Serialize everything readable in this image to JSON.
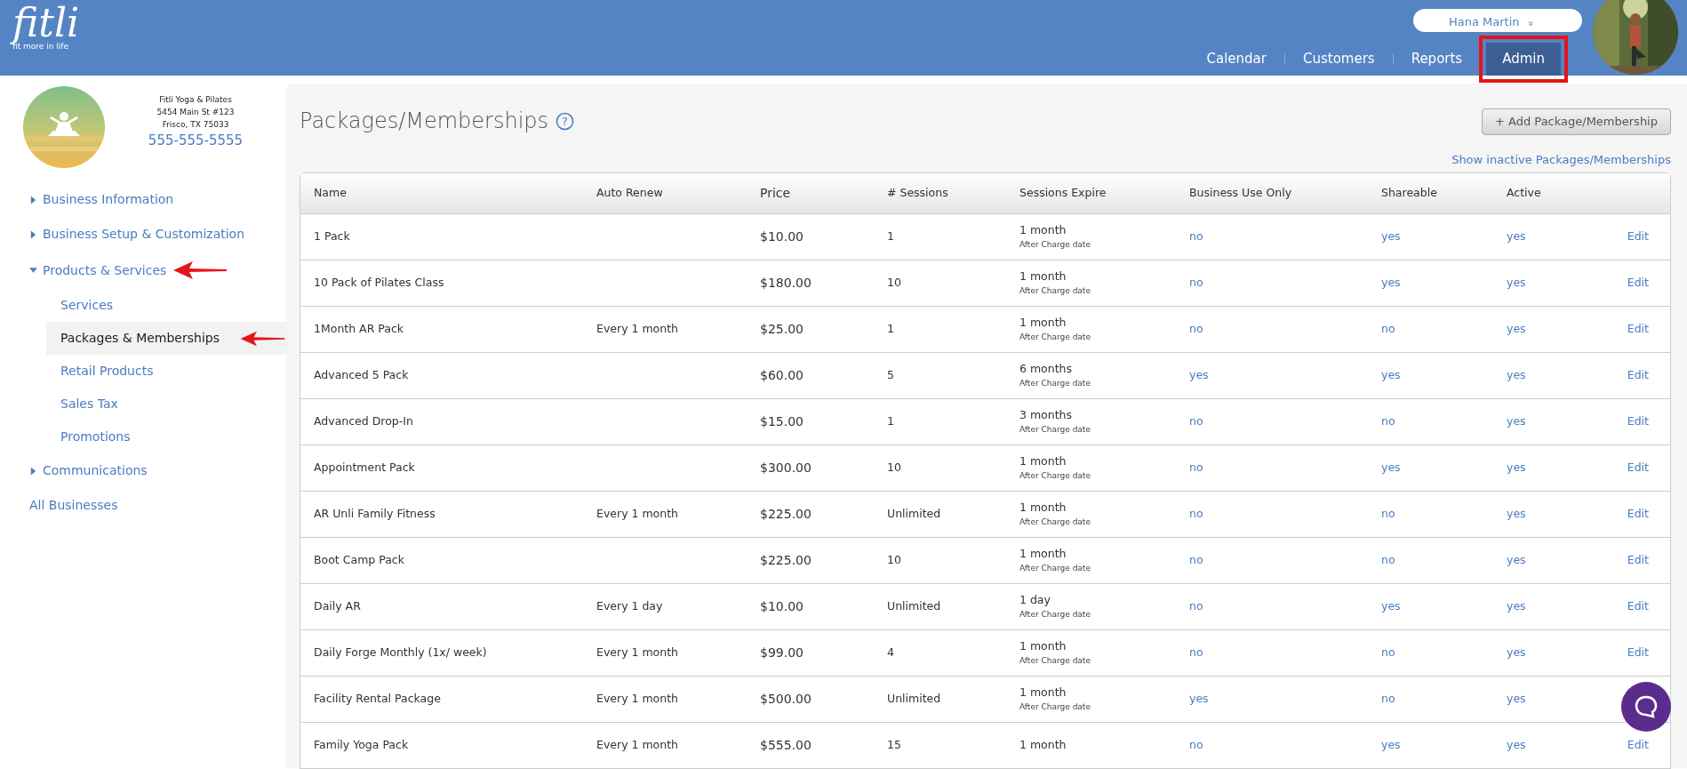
{
  "header": {
    "logo": "fitli",
    "tagline": "fit more in life",
    "user": "Hana Martin",
    "user_caret": "»",
    "nav": [
      {
        "label": "Calendar",
        "selected": false
      },
      {
        "label": "Customers",
        "selected": false
      },
      {
        "label": "Reports",
        "selected": false
      },
      {
        "label": "Admin",
        "selected": true
      }
    ]
  },
  "business": {
    "name": "Fitli Yoga & Pilates",
    "address_line_1": "5454 Main St #123",
    "address_line_2": "Frisco, TX 75033",
    "phone": "555-555-5555"
  },
  "sidebar": {
    "items": [
      {
        "label": "Business Information",
        "expanded": false,
        "selected": false
      },
      {
        "label": "Business Setup & Customization",
        "expanded": false,
        "selected": false
      },
      {
        "label": "Products & Services",
        "expanded": true,
        "selected": false,
        "annotated": true,
        "children": [
          {
            "label": "Services",
            "selected": false
          },
          {
            "label": "Packages & Memberships",
            "selected": true,
            "annotated": true
          },
          {
            "label": "Retail Products",
            "selected": false
          },
          {
            "label": "Sales Tax",
            "selected": false
          },
          {
            "label": "Promotions",
            "selected": false
          }
        ]
      },
      {
        "label": "Communications",
        "expanded": false,
        "selected": false
      },
      {
        "label": "All Businesses",
        "kind": "link",
        "selected": false
      }
    ]
  },
  "page": {
    "title": "Packages/Memberships",
    "help": "?",
    "add_button": "+ Add Package/Membership",
    "inactive_link": "Show inactive Packages/Memberships"
  },
  "table": {
    "columns": [
      "Name",
      "Auto Renew",
      "Price",
      "# Sessions",
      "Sessions Expire",
      "Business Use Only",
      "Shareable",
      "Active"
    ],
    "rows": [
      {
        "name": "1 Pack",
        "price": "$10.00",
        "sessions": "1",
        "expire": "1 month",
        "expire_note": "After Charge date",
        "business_only": "no",
        "shareable": "yes",
        "active": "yes",
        "action": "Edit"
      },
      {
        "name": "10 Pack of Pilates Class",
        "price": "$180.00",
        "sessions": "10",
        "expire": "1 month",
        "expire_note": "After Charge date",
        "business_only": "no",
        "shareable": "yes",
        "active": "yes",
        "action": "Edit"
      },
      {
        "name": "1Month AR Pack",
        "auto_renew": "Every 1 month",
        "price": "$25.00",
        "sessions": "1",
        "expire": "1 month",
        "expire_note": "After Charge date",
        "business_only": "no",
        "shareable": "no",
        "active": "yes",
        "action": "Edit"
      },
      {
        "name": "Advanced 5 Pack",
        "price": "$60.00",
        "sessions": "5",
        "expire": "6 months",
        "expire_note": "After Charge date",
        "business_only": "yes",
        "shareable": "yes",
        "active": "yes",
        "action": "Edit"
      },
      {
        "name": "Advanced Drop-In",
        "price": "$15.00",
        "sessions": "1",
        "expire": "3 months",
        "expire_note": "After Charge date",
        "business_only": "no",
        "shareable": "no",
        "active": "yes",
        "action": "Edit"
      },
      {
        "name": "Appointment Pack",
        "price": "$300.00",
        "sessions": "10",
        "expire": "1 month",
        "expire_note": "After Charge date",
        "business_only": "no",
        "shareable": "yes",
        "active": "yes",
        "action": "Edit"
      },
      {
        "name": "AR Unli Family Fitness",
        "auto_renew": "Every 1 month",
        "price": "$225.00",
        "sessions": "Unlimited",
        "expire": "1 month",
        "expire_note": "After Charge date",
        "business_only": "no",
        "shareable": "no",
        "active": "yes",
        "action": "Edit"
      },
      {
        "name": "Boot Camp Pack",
        "price": "$225.00",
        "sessions": "10",
        "expire": "1 month",
        "expire_note": "After Charge date",
        "business_only": "no",
        "shareable": "no",
        "active": "yes",
        "action": "Edit"
      },
      {
        "name": "Daily AR",
        "auto_renew": "Every 1 day",
        "price": "$10.00",
        "sessions": "Unlimited",
        "expire": "1 day",
        "expire_note": "After Charge date",
        "business_only": "no",
        "shareable": "yes",
        "active": "yes",
        "action": "Edit"
      },
      {
        "name": "Daily Forge Monthly (1x/ week)",
        "auto_renew": "Every 1 month",
        "price": "$99.00",
        "sessions": "4",
        "expire": "1 month",
        "expire_note": "After Charge date",
        "business_only": "no",
        "shareable": "no",
        "active": "yes",
        "action": "Edit"
      },
      {
        "name": "Facility Rental Package",
        "auto_renew": "Every 1 month",
        "price": "$500.00",
        "sessions": "Unlimited",
        "expire": "1 month",
        "expire_note": "After Charge date",
        "business_only": "yes",
        "shareable": "no",
        "active": "yes"
      },
      {
        "name": "Family Yoga Pack",
        "auto_renew": "Every 1 month",
        "price": "$555.00",
        "sessions": "15",
        "expire": "1 month",
        "business_only": "no",
        "shareable": "yes",
        "active": "yes",
        "action": "Edit"
      }
    ]
  }
}
